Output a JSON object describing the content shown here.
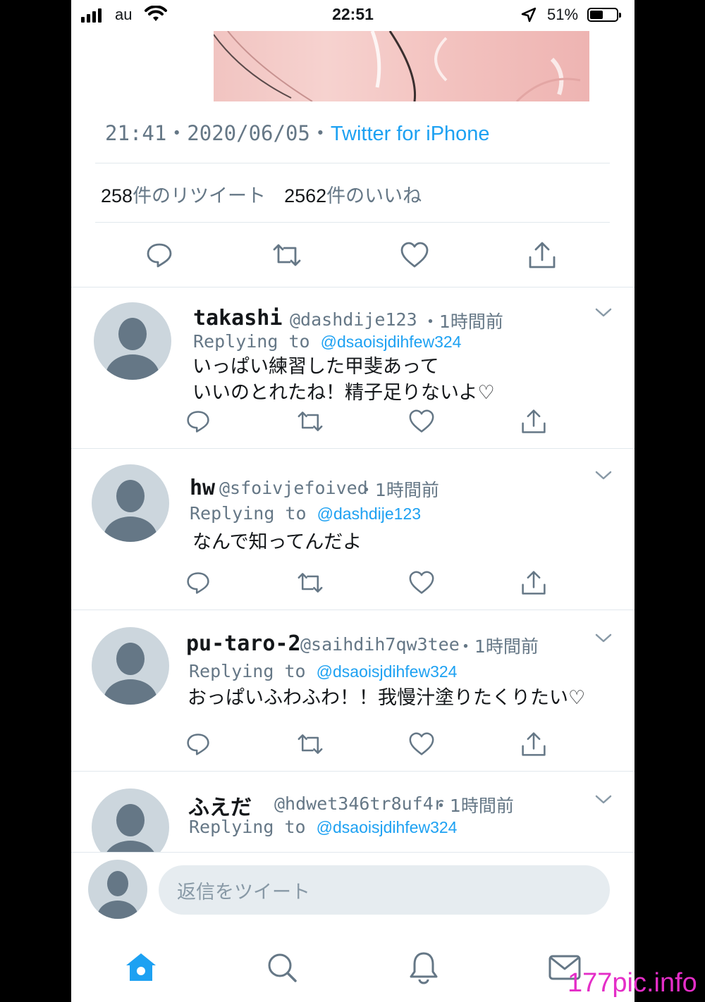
{
  "status_bar": {
    "carrier": "au",
    "time": "22:51",
    "battery_percent": "51%",
    "battery_level": 0.51
  },
  "tweet": {
    "timestamp": "21:41・2020/06/05・",
    "source": "Twitter for iPhone",
    "retweets_count": "258",
    "retweets_label": "件のリツイート",
    "likes_count": "2562",
    "likes_label": "件のいいね",
    "actions": [
      "reply-icon",
      "retweet-icon",
      "like-icon",
      "share-icon"
    ]
  },
  "replies": [
    {
      "name": "takashi",
      "handle": "@dashdije123",
      "time": "・1時間前",
      "replying_label": "Replying to",
      "replying_to": "@dsaoisjdihfew324",
      "text_line1": "いっぱい練習した甲斐あって",
      "text_line2": "いいのとれたね！精子足りないよ♡"
    },
    {
      "name": "hw",
      "handle": "@sfoivjefoived",
      "time": "・1時間前",
      "replying_label": "Replying to",
      "replying_to": "@dashdije123",
      "text_line1": "なんで知ってんだよ",
      "text_line2": ""
    },
    {
      "name": "pu-taro-2",
      "handle": "@saihdih7qw3tee",
      "time": "・1時間前",
      "replying_label": "Replying to",
      "replying_to": "@dsaoisjdihfew324",
      "text_line1": "おっぱいふわふわ！！我慢汁塗りたくりたい♡",
      "text_line2": ""
    },
    {
      "name": "ふえだ",
      "handle": "@hdwet346tr8uf4r",
      "time": "・1時間前",
      "replying_label": "Replying to",
      "replying_to": "@dsaoisjdihfew324",
      "text_line1": "",
      "text_line2": ""
    }
  ],
  "composer": {
    "placeholder": "返信をツイート"
  },
  "tabbar": [
    "home-icon",
    "search-icon",
    "notifications-icon",
    "messages-icon"
  ],
  "watermark": "177pic.info",
  "colors": {
    "accent": "#1da1f2",
    "secondary_text": "#657786",
    "divider": "#e1e8ed",
    "watermark": "#e42ec7"
  }
}
